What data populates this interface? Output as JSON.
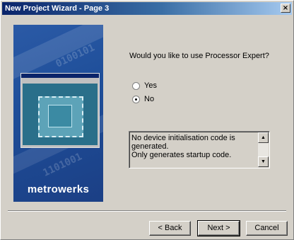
{
  "window": {
    "title": "New Project Wizard - Page  3",
    "close_label": "×"
  },
  "banner": {
    "logo_text": "metrowerks",
    "binary_text_1": "0100101",
    "binary_text_2": "1101001"
  },
  "question": "Would you like to use Processor Expert?",
  "options": [
    {
      "label": "Yes",
      "selected": false
    },
    {
      "label": "No",
      "selected": true
    }
  ],
  "description": "No device initialisation code is generated.\nOnly generates startup code.",
  "buttons": {
    "back": "< Back",
    "next": "Next >",
    "cancel": "Cancel"
  }
}
